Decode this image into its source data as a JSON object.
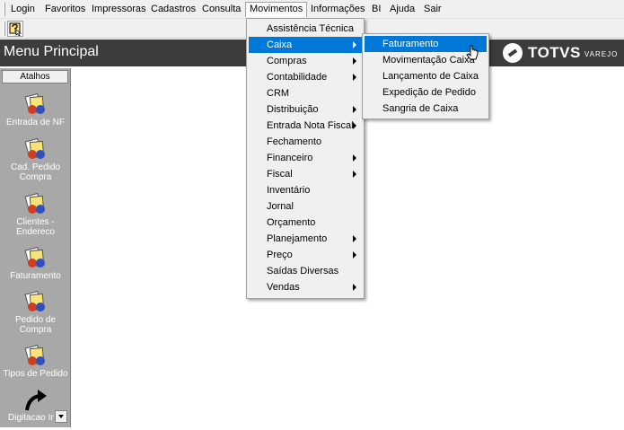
{
  "menubar": {
    "items": [
      "Login",
      "Favoritos",
      "Impressoras",
      "Cadastros",
      "Consulta",
      "Movimentos",
      "Informações",
      "BI",
      "Ajuda",
      "Sair"
    ]
  },
  "toolbar": {
    "button_icon": "help-cursor-icon"
  },
  "header": {
    "title": "Menu Principal"
  },
  "logo": {
    "word": "TOTVS",
    "sub": "VAREJO"
  },
  "atalhos": {
    "header": "Atalhos",
    "items": [
      {
        "label": "Entrada de NF",
        "icon": "document-stack-icon"
      },
      {
        "label": "Cad. Pedido Compra",
        "icon": "document-stack-icon"
      },
      {
        "label": "Clientes - Endereco",
        "icon": "document-stack-icon"
      },
      {
        "label": "Faturamento",
        "icon": "document-stack-icon"
      },
      {
        "label": "Pedido de Compra",
        "icon": "document-stack-icon"
      },
      {
        "label": "Tipos de Pedido",
        "icon": "document-stack-icon"
      },
      {
        "label": "Digitacao In",
        "icon": "curved-arrow-icon"
      }
    ]
  },
  "movimentos_menu": {
    "items": [
      {
        "label": "Assistência Técnica",
        "submenu": false
      },
      {
        "label": "Caixa",
        "submenu": true
      },
      {
        "label": "Compras",
        "submenu": true
      },
      {
        "label": "Contabilidade",
        "submenu": true
      },
      {
        "label": "CRM",
        "submenu": false
      },
      {
        "label": "Distribuição",
        "submenu": true
      },
      {
        "label": "Entrada Nota Fiscal",
        "submenu": true
      },
      {
        "label": "Fechamento",
        "submenu": false
      },
      {
        "label": "Financeiro",
        "submenu": true
      },
      {
        "label": "Fiscal",
        "submenu": true
      },
      {
        "label": "Inventário",
        "submenu": false
      },
      {
        "label": "Jornal",
        "submenu": false
      },
      {
        "label": "Orçamento",
        "submenu": false
      },
      {
        "label": "Planejamento",
        "submenu": true
      },
      {
        "label": "Preço",
        "submenu": true
      },
      {
        "label": "Saídas Diversas",
        "submenu": false
      },
      {
        "label": "Vendas",
        "submenu": true
      }
    ]
  },
  "caixa_menu": {
    "items": [
      "Faturamento",
      "Movimentação Caixa",
      "Lançamento de Caixa",
      "Expedição de Pedido",
      "Sangria de Caixa"
    ]
  },
  "colors": {
    "highlight": "#0078d7",
    "titlebar": "#3c3c3c",
    "panel": "#a8a8a8"
  }
}
